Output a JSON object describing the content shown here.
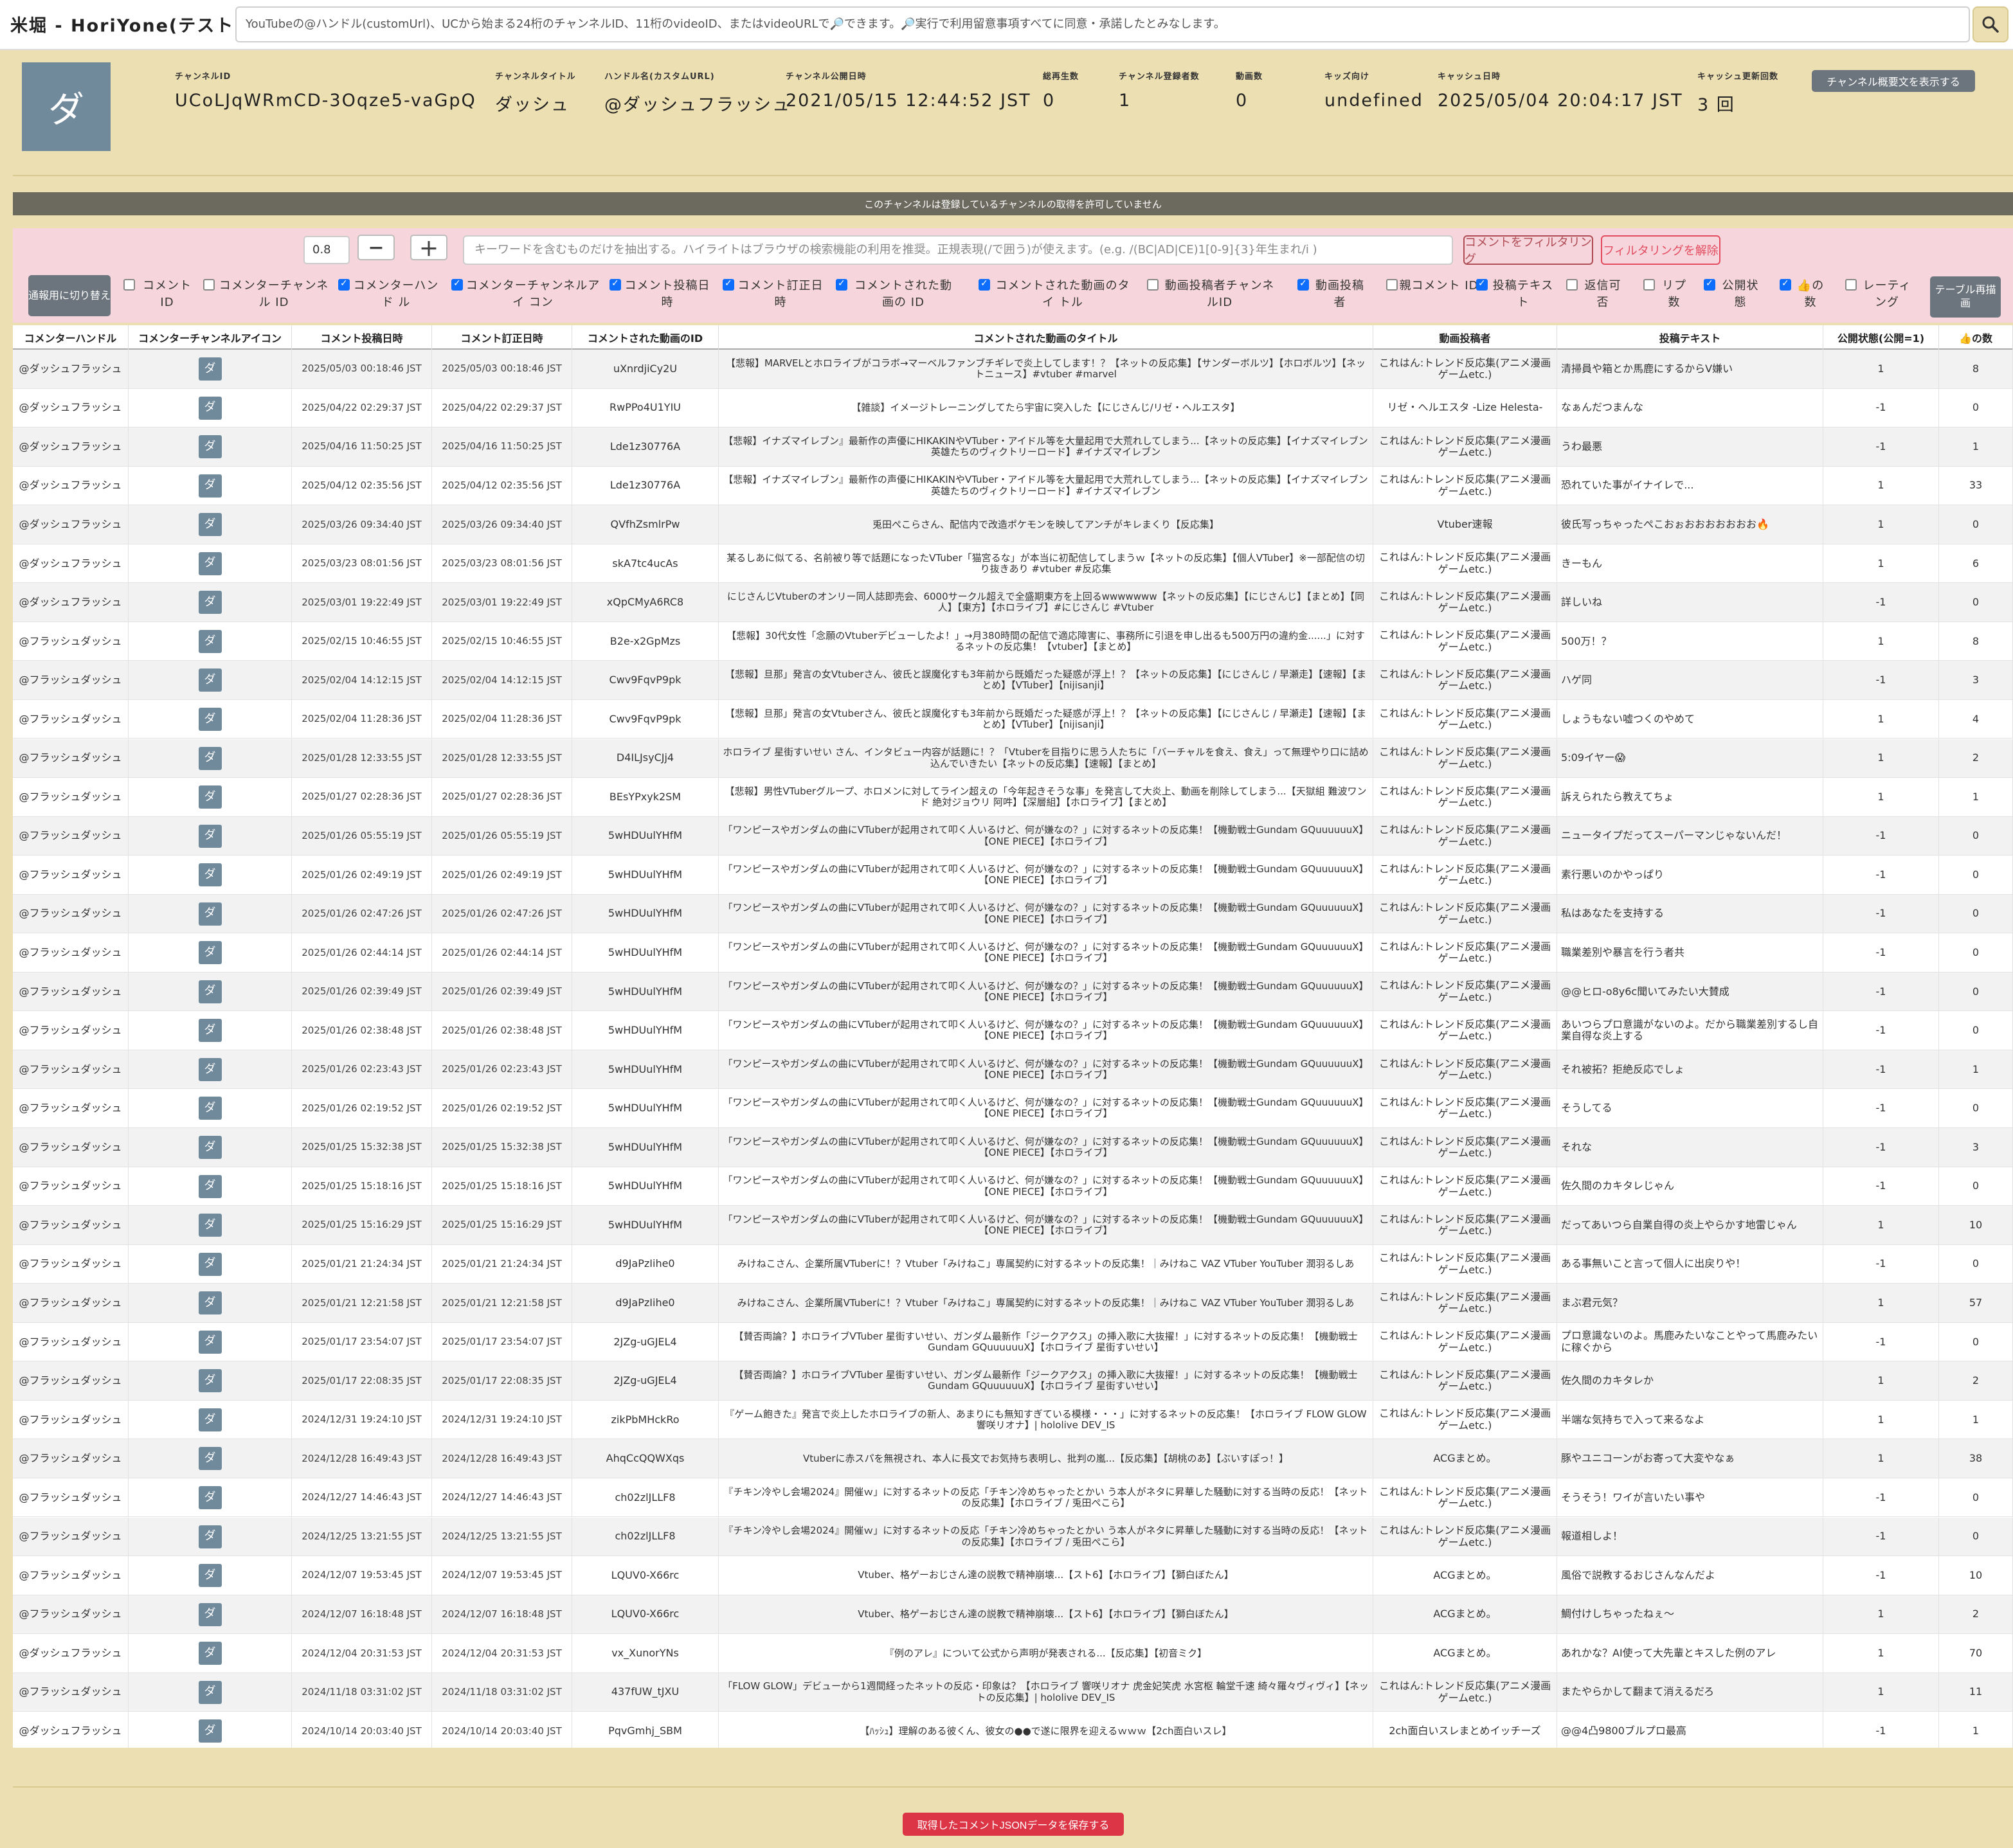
{
  "app": {
    "title": "米堀 - HoriYone(テスト中)",
    "search_placeholder": "YouTubeの@ハンドル(customUrl)、UCから始まる24桁のチャンネルID、11桁のvideoID、またはvideoURLで🔎できます。🔎実行で利用留意事項すべてに同意・承諾したとみなします。"
  },
  "channel": {
    "avatar_char": "ダ",
    "fields": [
      {
        "label": "チャンネルID",
        "value": "UCoLJqWRmCD-3Oqze5-vaGpQ"
      },
      {
        "label": "チャンネルタイトル",
        "value": "ダッシュ"
      },
      {
        "label": "ハンドル名(カスタムURL)",
        "value": "@ダッシュフラッシュ"
      },
      {
        "label": "チャンネル公開日時",
        "value": "2021/05/15 12:44:52 JST"
      },
      {
        "label": "総再生数",
        "value": "0"
      },
      {
        "label": "チャンネル登録者数",
        "value": "1"
      },
      {
        "label": "動画数",
        "value": "0"
      },
      {
        "label": "キッズ向け",
        "value": "undefined"
      },
      {
        "label": "キャッシュ日時",
        "value": "2025/05/04 20:04:17 JST"
      },
      {
        "label": "キャッシュ更新回数",
        "value": "3 回"
      }
    ],
    "show_desc_button": "チャンネル概要文を表示する"
  },
  "notice": "このチャンネルは登録しているチャンネルの取得を許可していません",
  "filter": {
    "zoom_value": "0.8",
    "minus_label": "−",
    "plus_label": "＋",
    "keyword_placeholder": "キーワードを含むものだけを抽出する。ハイライトはブラウザの検索機能の利用を推奨。正規表現(/で囲う)が使えます。(e.g. /(BC|AD|CE)1[0-9]{3}年生まれ/i )",
    "filter_button": "コメントをフィルタリング",
    "unfilter_button": "フィルタリングを解除",
    "toggle_button": "通報用に切り替え",
    "redraw_button": "テーブル再描画",
    "columns": [
      {
        "label": "コメント ID",
        "checked": false
      },
      {
        "label": "コメンターチャンネル ID",
        "checked": false
      },
      {
        "label": "コメンターハンド ル",
        "checked": true
      },
      {
        "label": "コメンターチャンネルアイ コン",
        "checked": true
      },
      {
        "label": "コメント投稿日 時",
        "checked": true
      },
      {
        "label": "コメント訂正日 時",
        "checked": true
      },
      {
        "label": "コメントされた動画の ID",
        "checked": true
      },
      {
        "label": "コメントされた動画のタイ トル",
        "checked": true
      },
      {
        "label": "動画投稿者チャンネ ルID",
        "checked": false
      },
      {
        "label": "動画投稿 者",
        "checked": true
      },
      {
        "label": "親コメント ID",
        "checked": false
      },
      {
        "label": "投稿テキス ト",
        "checked": true
      },
      {
        "label": "返信可 否",
        "checked": false
      },
      {
        "label": "リプ 数",
        "checked": false
      },
      {
        "label": "公開状 態",
        "checked": true
      },
      {
        "label": "👍の 数",
        "checked": true
      },
      {
        "label": "レーティ ング",
        "checked": false
      }
    ]
  },
  "table": {
    "headers": [
      "コメンターハンドル",
      "コメンターチャンネルアイコン",
      "コメント投稿日時",
      "コメント訂正日時",
      "コメントされた動画のID",
      "コメントされた動画のタイトル",
      "動画投稿者",
      "投稿テキスト",
      "公開状態(公開=1)",
      "👍の数"
    ],
    "rows": [
      {
        "handle": "@ダッシュフラッシュ",
        "posted": "2025/05/03 00:18:46 JST",
        "edited": "2025/05/03 00:18:46 JST",
        "video_id": "uXnrdjiCy2U",
        "title": "【悲報】MARVELとホロライブがコラボ→マーベルファンブチギレで炎上してします！？【ネットの反応集】【サンダーボルツ】【ホロボルツ】【ネットニュース】#vtuber #marvel",
        "uploader": "これはん:トレンド反応集(アニメ漫画ゲームetc.)",
        "text": "清掃員や箱とか馬鹿にするからV嫌い",
        "public": "1",
        "likes": "8"
      },
      {
        "handle": "@ダッシュフラッシュ",
        "posted": "2025/04/22 02:29:37 JST",
        "edited": "2025/04/22 02:29:37 JST",
        "video_id": "RwPPo4U1YIU",
        "title": "【雑談】イメージトレーニングしてたら宇宙に突入した【にじさんじ/リゼ・ヘルエスタ】",
        "uploader": "リゼ・ヘルエスタ -Lize Helesta-",
        "text": "なぁんだつまんな",
        "public": "-1",
        "likes": "0"
      },
      {
        "handle": "@ダッシュフラッシュ",
        "posted": "2025/04/16 11:50:25 JST",
        "edited": "2025/04/16 11:50:25 JST",
        "video_id": "Lde1z30776A",
        "title": "【悲報】イナズマイレブン』最新作の声優にHIKAKINやVTuber・アイドル等を大量起用で大荒れしてしまう...【ネットの反応集】【イナズマイレブン 英雄たちのヴィクトリーロード】#イナズマイレブン",
        "uploader": "これはん:トレンド反応集(アニメ漫画ゲームetc.)",
        "text": "うわ最悪",
        "public": "-1",
        "likes": "1"
      },
      {
        "handle": "@ダッシュフラッシュ",
        "posted": "2025/04/12 02:35:56 JST",
        "edited": "2025/04/12 02:35:56 JST",
        "video_id": "Lde1z30776A",
        "title": "【悲報】イナズマイレブン』最新作の声優にHIKAKINやVTuber・アイドル等を大量起用で大荒れしてしまう...【ネットの反応集】【イナズマイレブン 英雄たちのヴィクトリーロード】#イナズマイレブン",
        "uploader": "これはん:トレンド反応集(アニメ漫画ゲームetc.)",
        "text": "恐れていた事がイナイレで...",
        "public": "1",
        "likes": "33"
      },
      {
        "handle": "@ダッシュフラッシュ",
        "posted": "2025/03/26 09:34:40 JST",
        "edited": "2025/03/26 09:34:40 JST",
        "video_id": "QVfhZsmlrPw",
        "title": "兎田ぺこらさん、配信内で改造ポケモンを映してアンチがキレまくり【反応集】",
        "uploader": "Vtuber速報",
        "text": "彼氏写っちゃったぺこおぉおおおおおおお🔥",
        "public": "1",
        "likes": "0"
      },
      {
        "handle": "@ダッシュフラッシュ",
        "posted": "2025/03/23 08:01:56 JST",
        "edited": "2025/03/23 08:01:56 JST",
        "video_id": "skA7tc4ucAs",
        "title": "某るしあに似てる、名前被り等で話題になったVTuber「猫宮るな」が本当に初配信してしまうｗ【ネットの反応集】【個人VTuber】※一部配信の切り抜きあり #vtuber #反応集",
        "uploader": "これはん:トレンド反応集(アニメ漫画ゲームetc.)",
        "text": "きーもん",
        "public": "1",
        "likes": "6"
      },
      {
        "handle": "@ダッシュフラッシュ",
        "posted": "2025/03/01 19:22:49 JST",
        "edited": "2025/03/01 19:22:49 JST",
        "video_id": "xQpCMyA6RC8",
        "title": "にじさんじVtuberのオンリー同人誌即売会、6000サークル超えで全盛期東方を上回るwwwwwww【ネットの反応集】【にじさんじ】【まとめ】【同人】【東方】【ホロライブ】#にじさんじ #Vtuber",
        "uploader": "これはん:トレンド反応集(アニメ漫画ゲームetc.)",
        "text": "詳しいね",
        "public": "-1",
        "likes": "0"
      },
      {
        "handle": "@フラッシュダッシュ",
        "posted": "2025/02/15 10:46:55 JST",
        "edited": "2025/02/15 10:46:55 JST",
        "video_id": "B2e-x2GpMzs",
        "title": "【悲報】30代女性「念願のVtuberデビューしたよ！」→月380時間の配信で適応障害に、事務所に引退を申し出るも500万円の違約金......」に対するネットの反応集！【vtuber】【まとめ】",
        "uploader": "これはん:トレンド反応集(アニメ漫画ゲームetc.)",
        "text": "500万！？",
        "public": "1",
        "likes": "8"
      },
      {
        "handle": "@フラッシュダッシュ",
        "posted": "2025/02/04 14:12:15 JST",
        "edited": "2025/02/04 14:12:15 JST",
        "video_id": "Cwv9FqvP9pk",
        "title": "【悲報】旦那」発言の女Vtuberさん、彼氏と誤魔化すも3年前から既婚だった疑惑が浮上！？【ネットの反応集】【にじさんじ / 早瀬走】【速報】【まとめ】【VTuber】【nijisanji】",
        "uploader": "これはん:トレンド反応集(アニメ漫画ゲームetc.)",
        "text": "ハゲ同",
        "public": "-1",
        "likes": "3"
      },
      {
        "handle": "@フラッシュダッシュ",
        "posted": "2025/02/04 11:28:36 JST",
        "edited": "2025/02/04 11:28:36 JST",
        "video_id": "Cwv9FqvP9pk",
        "title": "【悲報】旦那」発言の女Vtuberさん、彼氏と誤魔化すも3年前から既婚だった疑惑が浮上！？【ネットの反応集】【にじさんじ / 早瀬走】【速報】【まとめ】【VTuber】【nijisanji】",
        "uploader": "これはん:トレンド反応集(アニメ漫画ゲームetc.)",
        "text": "しょうもない嘘つくのやめて",
        "public": "1",
        "likes": "4"
      },
      {
        "handle": "@フラッシュダッシュ",
        "posted": "2025/01/28 12:33:55 JST",
        "edited": "2025/01/28 12:33:55 JST",
        "video_id": "D4ILJsyCJj4",
        "title": "ホロライブ 星街すいせい さん、インタビュー内容が話題に！？「Vtuberを目指りに思う人たちに「バーチャルを食え、食え」って無理やり口に詰め込んでいきたい【ネットの反応集】【速報】【まとめ】",
        "uploader": "これはん:トレンド反応集(アニメ漫画ゲームetc.)",
        "text": "5:09イヤー😱",
        "public": "1",
        "likes": "2"
      },
      {
        "handle": "@フラッシュダッシュ",
        "posted": "2025/01/27 02:28:36 JST",
        "edited": "2025/01/27 02:28:36 JST",
        "video_id": "BEsYPxyk2SM",
        "title": "【悲報】男性VTuberグループ、ホロメンに対してライン超えの「今年起きそうな事」を発言して大炎上、動画を削除してしまう...【天獄組 難波ワンド 絶対ジョウリ 阿吽】【深層組】【ホロライブ】【まとめ】",
        "uploader": "これはん:トレンド反応集(アニメ漫画ゲームetc.)",
        "text": "訴えられたら教えてちょ",
        "public": "1",
        "likes": "1"
      },
      {
        "handle": "@フラッシュダッシュ",
        "posted": "2025/01/26 05:55:19 JST",
        "edited": "2025/01/26 05:55:19 JST",
        "video_id": "5wHDUulYHfM",
        "title": "「ワンピースやガンダムの曲にVTuberが起用されて叩く人いるけど、何が嫌なの？」に対するネットの反応集！【機動戦士Gundam GQuuuuuuX】【ONE PIECE】【ホロライブ】",
        "uploader": "これはん:トレンド反応集(アニメ漫画ゲームetc.)",
        "text": "ニュータイプだってスーパーマンじゃないんだ！",
        "public": "-1",
        "likes": "0"
      },
      {
        "handle": "@フラッシュダッシュ",
        "posted": "2025/01/26 02:49:19 JST",
        "edited": "2025/01/26 02:49:19 JST",
        "video_id": "5wHDUulYHfM",
        "title": "「ワンピースやガンダムの曲にVTuberが起用されて叩く人いるけど、何が嫌なの？」に対するネットの反応集！【機動戦士Gundam GQuuuuuuX】【ONE PIECE】【ホロライブ】",
        "uploader": "これはん:トレンド反応集(アニメ漫画ゲームetc.)",
        "text": "素行悪いのかやっぱり",
        "public": "-1",
        "likes": "0"
      },
      {
        "handle": "@フラッシュダッシュ",
        "posted": "2025/01/26 02:47:26 JST",
        "edited": "2025/01/26 02:47:26 JST",
        "video_id": "5wHDUulYHfM",
        "title": "「ワンピースやガンダムの曲にVTuberが起用されて叩く人いるけど、何が嫌なの？」に対するネットの反応集！【機動戦士Gundam GQuuuuuuX】【ONE PIECE】【ホロライブ】",
        "uploader": "これはん:トレンド反応集(アニメ漫画ゲームetc.)",
        "text": "私はあなたを支持する",
        "public": "-1",
        "likes": "0"
      },
      {
        "handle": "@フラッシュダッシュ",
        "posted": "2025/01/26 02:44:14 JST",
        "edited": "2025/01/26 02:44:14 JST",
        "video_id": "5wHDUulYHfM",
        "title": "「ワンピースやガンダムの曲にVTuberが起用されて叩く人いるけど、何が嫌なの？」に対するネットの反応集！【機動戦士Gundam GQuuuuuuX】【ONE PIECE】【ホロライブ】",
        "uploader": "これはん:トレンド反応集(アニメ漫画ゲームetc.)",
        "text": "職業差別や暴言を行う者共",
        "public": "-1",
        "likes": "0"
      },
      {
        "handle": "@フラッシュダッシュ",
        "posted": "2025/01/26 02:39:49 JST",
        "edited": "2025/01/26 02:39:49 JST",
        "video_id": "5wHDUulYHfM",
        "title": "「ワンピースやガンダムの曲にVTuberが起用されて叩く人いるけど、何が嫌なの？」に対するネットの反応集！【機動戦士Gundam GQuuuuuuX】【ONE PIECE】【ホロライブ】",
        "uploader": "これはん:トレンド反応集(アニメ漫画ゲームetc.)",
        "text": "@@ヒロ-o8y6c聞いてみたい大賛成",
        "public": "-1",
        "likes": "0"
      },
      {
        "handle": "@フラッシュダッシュ",
        "posted": "2025/01/26 02:38:48 JST",
        "edited": "2025/01/26 02:38:48 JST",
        "video_id": "5wHDUulYHfM",
        "title": "「ワンピースやガンダムの曲にVTuberが起用されて叩く人いるけど、何が嫌なの？」に対するネットの反応集！【機動戦士Gundam GQuuuuuuX】【ONE PIECE】【ホロライブ】",
        "uploader": "これはん:トレンド反応集(アニメ漫画ゲームetc.)",
        "text": "あいつらプロ意識がないのよ。だから職業差別するし自業自得な炎上する",
        "public": "-1",
        "likes": "0"
      },
      {
        "handle": "@フラッシュダッシュ",
        "posted": "2025/01/26 02:23:43 JST",
        "edited": "2025/01/26 02:23:43 JST",
        "video_id": "5wHDUulYHfM",
        "title": "「ワンピースやガンダムの曲にVTuberが起用されて叩く人いるけど、何が嫌なの？」に対するネットの反応集！【機動戦士Gundam GQuuuuuuX】【ONE PIECE】【ホロライブ】",
        "uploader": "これはん:トレンド反応集(アニメ漫画ゲームetc.)",
        "text": "それ被拓？拒絶反応でしょ",
        "public": "-1",
        "likes": "1"
      },
      {
        "handle": "@フラッシュダッシュ",
        "posted": "2025/01/26 02:19:52 JST",
        "edited": "2025/01/26 02:19:52 JST",
        "video_id": "5wHDUulYHfM",
        "title": "「ワンピースやガンダムの曲にVTuberが起用されて叩く人いるけど、何が嫌なの？」に対するネットの反応集！【機動戦士Gundam GQuuuuuuX】【ONE PIECE】【ホロライブ】",
        "uploader": "これはん:トレンド反応集(アニメ漫画ゲームetc.)",
        "text": "そうしてる",
        "public": "-1",
        "likes": "0"
      },
      {
        "handle": "@フラッシュダッシュ",
        "posted": "2025/01/25 15:32:38 JST",
        "edited": "2025/01/25 15:32:38 JST",
        "video_id": "5wHDUulYHfM",
        "title": "「ワンピースやガンダムの曲にVTuberが起用されて叩く人いるけど、何が嫌なの？」に対するネットの反応集！【機動戦士Gundam GQuuuuuuX】【ONE PIECE】【ホロライブ】",
        "uploader": "これはん:トレンド反応集(アニメ漫画ゲームetc.)",
        "text": "それな",
        "public": "-1",
        "likes": "3"
      },
      {
        "handle": "@フラッシュダッシュ",
        "posted": "2025/01/25 15:18:16 JST",
        "edited": "2025/01/25 15:18:16 JST",
        "video_id": "5wHDUulYHfM",
        "title": "「ワンピースやガンダムの曲にVTuberが起用されて叩く人いるけど、何が嫌なの？」に対するネットの反応集！【機動戦士Gundam GQuuuuuuX】【ONE PIECE】【ホロライブ】",
        "uploader": "これはん:トレンド反応集(アニメ漫画ゲームetc.)",
        "text": "佐久間のカキタレじゃん",
        "public": "-1",
        "likes": "0"
      },
      {
        "handle": "@フラッシュダッシュ",
        "posted": "2025/01/25 15:16:29 JST",
        "edited": "2025/01/25 15:16:29 JST",
        "video_id": "5wHDUulYHfM",
        "title": "「ワンピースやガンダムの曲にVTuberが起用されて叩く人いるけど、何が嫌なの？」に対するネットの反応集！【機動戦士Gundam GQuuuuuuX】【ONE PIECE】【ホロライブ】",
        "uploader": "これはん:トレンド反応集(アニメ漫画ゲームetc.)",
        "text": "だってあいつら自業自得の炎上やらかす地雷じゃん",
        "public": "1",
        "likes": "10"
      },
      {
        "handle": "@フラッシュダッシュ",
        "posted": "2025/01/21 21:24:34 JST",
        "edited": "2025/01/21 21:24:34 JST",
        "video_id": "d9JaPzIihe0",
        "title": "みけねこさん、企業所属VTuberに！？Vtuber「みけねこ」専属契約に対するネットの反応集！｜みけねこ VAZ VTuber YouTuber 潤羽るしあ",
        "uploader": "これはん:トレンド反応集(アニメ漫画ゲームetc.)",
        "text": "ある事無いこと言って個人に出戻りや！",
        "public": "-1",
        "likes": "0"
      },
      {
        "handle": "@フラッシュダッシュ",
        "posted": "2025/01/21 12:21:58 JST",
        "edited": "2025/01/21 12:21:58 JST",
        "video_id": "d9JaPzIihe0",
        "title": "みけねこさん、企業所属VTuberに！？Vtuber「みけねこ」専属契約に対するネットの反応集！｜みけねこ VAZ VTuber YouTuber 潤羽るしあ",
        "uploader": "これはん:トレンド反応集(アニメ漫画ゲームetc.)",
        "text": "まぶ君元気？",
        "public": "1",
        "likes": "57"
      },
      {
        "handle": "@フラッシュダッシュ",
        "posted": "2025/01/17 23:54:07 JST",
        "edited": "2025/01/17 23:54:07 JST",
        "video_id": "2JZg-uGJEL4",
        "title": "【賛否両論？】ホロライブVTuber 星街すいせい、ガンダム最新作「ジークアクス」の挿入歌に大抜擢！」に対するネットの反応集！【機動戦士Gundam GQuuuuuuX】【ホロライブ 星街すいせい】",
        "uploader": "これはん:トレンド反応集(アニメ漫画ゲームetc.)",
        "text": "プロ意識ないのよ。馬鹿みたいなことやって馬鹿みたいに稼ぐから",
        "public": "-1",
        "likes": "0"
      },
      {
        "handle": "@フラッシュダッシュ",
        "posted": "2025/01/17 22:08:35 JST",
        "edited": "2025/01/17 22:08:35 JST",
        "video_id": "2JZg-uGJEL4",
        "title": "【賛否両論？】ホロライブVTuber 星街すいせい、ガンダム最新作「ジークアクス」の挿入歌に大抜擢！」に対するネットの反応集！【機動戦士Gundam GQuuuuuuX】【ホロライブ 星街すいせい】",
        "uploader": "これはん:トレンド反応集(アニメ漫画ゲームetc.)",
        "text": "佐久間のカキタレか",
        "public": "1",
        "likes": "2"
      },
      {
        "handle": "@フラッシュダッシュ",
        "posted": "2024/12/31 19:24:10 JST",
        "edited": "2024/12/31 19:24:10 JST",
        "video_id": "zikPbMHckRo",
        "title": "『ゲーム飽きた』発言で炎上したホロライブの新人、あまりにも無知すぎている模様・・・」に対するネットの反応集！【ホロライブ FLOW GLOW 響咲リオナ】| hololive DEV_IS",
        "uploader": "これはん:トレンド反応集(アニメ漫画ゲームetc.)",
        "text": "半端な気持ちで入って来るなよ",
        "public": "1",
        "likes": "1"
      },
      {
        "handle": "@フラッシュダッシュ",
        "posted": "2024/12/28 16:49:43 JST",
        "edited": "2024/12/28 16:49:43 JST",
        "video_id": "AhqCcQQWXqs",
        "title": "Vtuberに赤スパを無視され、本人に長文でお気持ち表明し、批判の嵐...【反応集】【胡桃のあ】【ぶいすぽっ！】",
        "uploader": "ACGまとめ。",
        "text": "豚やユニコーンがお寄って大変やなぁ",
        "public": "1",
        "likes": "38"
      },
      {
        "handle": "@フラッシュダッシュ",
        "posted": "2024/12/27 14:46:43 JST",
        "edited": "2024/12/27 14:46:43 JST",
        "video_id": "ch02zlJLLF8",
        "title": "『チキン冷やし会場2024』開催ｗ」に対するネットの反応「チキン冷めちゃったとかい う本人がネタに昇華した騒動に対する当時の反応！【ネットの反応集】【ホロライブ / 兎田ぺこら】",
        "uploader": "これはん:トレンド反応集(アニメ漫画ゲームetc.)",
        "text": "そうそう！ワイが言いたい事や",
        "public": "-1",
        "likes": "0"
      },
      {
        "handle": "@フラッシュダッシュ",
        "posted": "2024/12/25 13:21:55 JST",
        "edited": "2024/12/25 13:21:55 JST",
        "video_id": "ch02zlJLLF8",
        "title": "『チキン冷やし会場2024』開催ｗ」に対するネットの反応「チキン冷めちゃったとかい う本人がネタに昇華した騒動に対する当時の反応！【ネットの反応集】【ホロライブ / 兎田ぺこら】",
        "uploader": "これはん:トレンド反応集(アニメ漫画ゲームetc.)",
        "text": "報道相しよ！",
        "public": "-1",
        "likes": "0"
      },
      {
        "handle": "@フラッシュダッシュ",
        "posted": "2024/12/07 19:53:45 JST",
        "edited": "2024/12/07 19:53:45 JST",
        "video_id": "LQUV0-X66rc",
        "title": "Vtuber、格ゲーおじさん達の説教で精神崩壊...【スト6】【ホロライブ】【獅白ぼたん】",
        "uploader": "ACGまとめ。",
        "text": "風俗で説教するおじさんなんだよ",
        "public": "-1",
        "likes": "10"
      },
      {
        "handle": "@フラッシュダッシュ",
        "posted": "2024/12/07 16:18:48 JST",
        "edited": "2024/12/07 16:18:48 JST",
        "video_id": "LQUV0-X66rc",
        "title": "Vtuber、格ゲーおじさん達の説教で精神崩壊...【スト6】【ホロライブ】【獅白ぼたん】",
        "uploader": "ACGまとめ。",
        "text": "鯛付けしちゃったねぇ〜",
        "public": "1",
        "likes": "2"
      },
      {
        "handle": "@ダッシュフラッシュ",
        "posted": "2024/12/04 20:31:53 JST",
        "edited": "2024/12/04 20:31:53 JST",
        "video_id": "vx_XunorYNs",
        "title": "『例のアレ』について公式から声明が発表される...【反応集】【初音ミク】",
        "uploader": "ACGまとめ。",
        "text": "あれかな？AI使って大先輩とキスした例のアレ",
        "public": "1",
        "likes": "70"
      },
      {
        "handle": "@フラッシュダッシュ",
        "posted": "2024/11/18 03:31:02 JST",
        "edited": "2024/11/18 03:31:02 JST",
        "video_id": "437fUW_tJXU",
        "title": "「FLOW GLOW」デビューから1週間経ったネットの反応・印象は？【ホロライブ 響咲リオナ 虎金妃笑虎 水宮枢 輪堂千速 綺々羅々ヴィヴィ】【ネットの反応集】| hololive DEV_IS",
        "uploader": "これはん:トレンド反応集(アニメ漫画ゲームetc.)",
        "text": "またやらかして翻まて消えるだろ",
        "public": "1",
        "likes": "11"
      },
      {
        "handle": "@ダッシュフラッシュ",
        "posted": "2024/10/14 20:03:40 JST",
        "edited": "2024/10/14 20:03:40 JST",
        "video_id": "PqvGmhj_SBM",
        "title": "【ﾊｯｼｭ】理解のある彼くん、彼女の●●で遂に限界を迎えるｗｗｗ【2ch面白いスレ】",
        "uploader": "2ch面白いスレまとめイッチーズ",
        "text": "@@4凸9800ブルプロ最高",
        "public": "-1",
        "likes": "1"
      }
    ]
  },
  "footer": {
    "save_button": "取得したコメントJSONデータを保存する"
  }
}
